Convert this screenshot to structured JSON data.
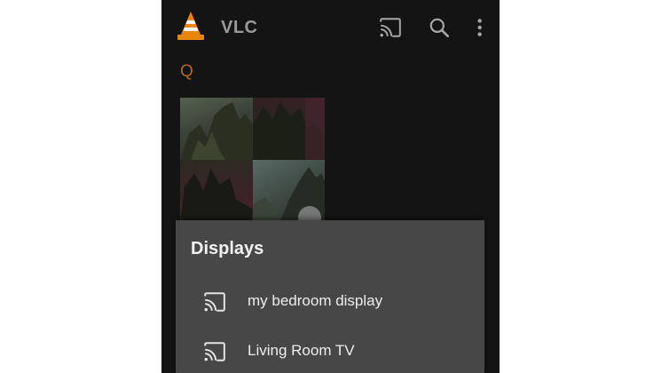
{
  "app": {
    "title": "VLC",
    "logo_icon": "vlc-cone-icon",
    "accent_color": "#e8850c"
  },
  "toolbar": {
    "cast_icon": "cast-icon",
    "search_icon": "search-icon",
    "more_icon": "more-vert-icon"
  },
  "library": {
    "section_letter": "Q",
    "thumbnail_icon": "play-icon"
  },
  "displays_sheet": {
    "title": "Displays",
    "items": [
      {
        "label": "my bedroom display",
        "icon": "cast-icon"
      },
      {
        "label": "Living Room TV",
        "icon": "cast-icon"
      }
    ]
  }
}
